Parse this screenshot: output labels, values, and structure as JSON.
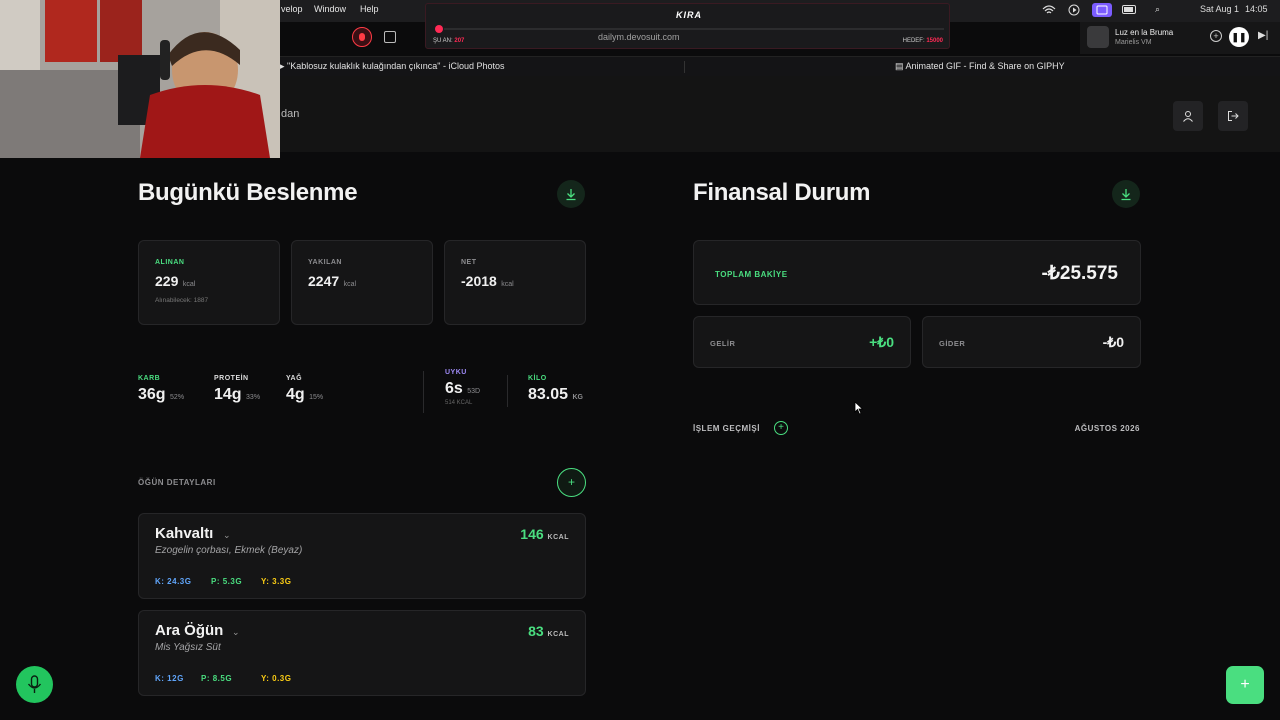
{
  "menubar": {
    "menus": [
      "velop",
      "Window",
      "Help"
    ],
    "date": "Sat Aug 1",
    "time": "14:05"
  },
  "recorder": {
    "brand": "KIRA",
    "sofar_label": "ŞU AN:",
    "sofar_value": "207",
    "goal_label": "HEDEF:",
    "goal_value": "15000",
    "url": "dailym.devosuit.com"
  },
  "now_playing": {
    "title": "Luz en la Bruma",
    "artist": "Marielis VM"
  },
  "browser_tabs": [
    "\"Kablosuz kulaklık kulağından çıkınca\" - iCloud Photos",
    "Animated GIF - Find & Share on GIPHY"
  ],
  "header": {
    "partial_text": "dan"
  },
  "nutrition": {
    "title": "Bugünkü Beslenme",
    "cards": [
      {
        "label": "ALINAN",
        "value": "229",
        "unit": "kcal",
        "sub": "Alınabilecek: 1887"
      },
      {
        "label": "YAKILAN",
        "value": "2247",
        "unit": "kcal"
      },
      {
        "label": "NET",
        "value": "-2018",
        "unit": "kcal"
      }
    ],
    "macros": [
      {
        "label": "KARB",
        "value": "36g",
        "pct": "52%"
      },
      {
        "label": "PROTEİN",
        "value": "14g",
        "pct": "33%"
      },
      {
        "label": "YAĞ",
        "value": "4g",
        "pct": "15%"
      }
    ],
    "sleep": {
      "label": "UYKU",
      "value": "6s",
      "unit": "53D",
      "sub": "514 KCAL"
    },
    "weight": {
      "label": "KİLO",
      "value": "83.05",
      "unit": "KG"
    },
    "meals_title": "ÖĞÜN DETAYLARI",
    "meals": [
      {
        "name": "Kahvaltı",
        "desc": "Ezogelin çorbası, Ekmek (Beyaz)",
        "kcal": "146",
        "kcal_unit": "KCAL",
        "k": "K: 24.3G",
        "p": "P: 5.3G",
        "y": "Y: 3.3G"
      },
      {
        "name": "Ara Öğün",
        "desc": "Mis Yağsız Süt",
        "kcal": "83",
        "kcal_unit": "KCAL",
        "k": "K: 12G",
        "p": "P: 8.5G",
        "y": "Y: 0.3G"
      }
    ]
  },
  "finance": {
    "title": "Finansal Durum",
    "balance_label": "TOPLAM BAKİYE",
    "balance": "-₺25.575",
    "income_label": "GELİR",
    "income": "+₺0",
    "expense_label": "GİDER",
    "expense": "-₺0",
    "history_label": "İŞLEM GEÇMİŞİ",
    "month": "AĞUSTOS 2026"
  },
  "colors": {
    "accent_green": "#4ade80",
    "purple": "#9f8bf7",
    "carb_blue": "#60a5fa",
    "protein_green": "#4ade80",
    "fat_yellow": "#facc15"
  }
}
